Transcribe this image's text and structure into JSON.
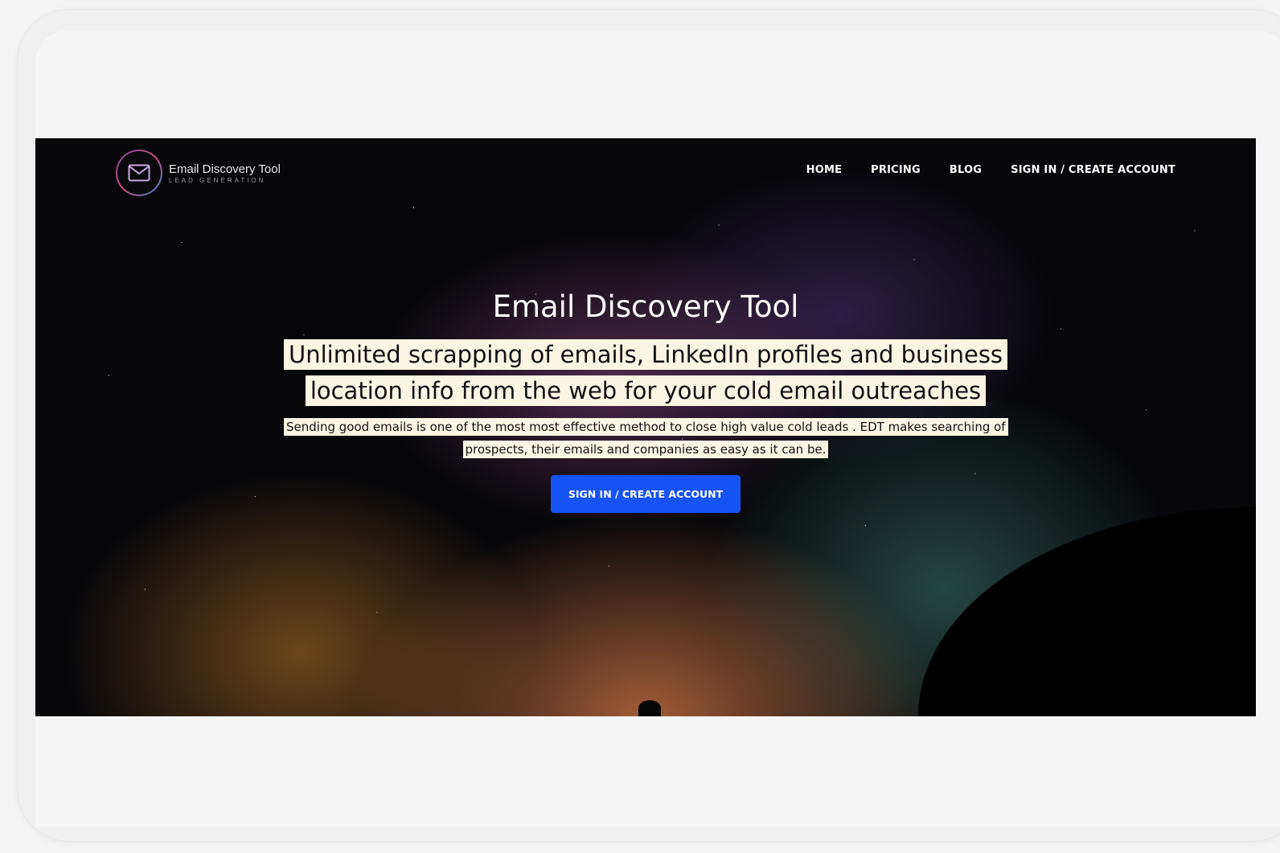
{
  "brand": {
    "name": "Email Discovery Tool",
    "tagline": "LEAD GENERATION"
  },
  "nav": {
    "items": [
      {
        "label": "HOME"
      },
      {
        "label": "PRICING"
      },
      {
        "label": "BLOG"
      },
      {
        "label": "SIGN IN / CREATE ACCOUNT"
      }
    ]
  },
  "hero": {
    "title": "Email Discovery Tool",
    "subtitle": "Unlimited scrapping of emails, LinkedIn profiles and business location info from the web for your cold email outreaches",
    "description": "Sending good emails is one of the most most effective method to close high value cold leads . EDT makes searching of prospects, their emails and companies as easy as it can be.",
    "cta_label": "SIGN IN / CREATE ACCOUNT"
  },
  "colors": {
    "cta": "#1553f5",
    "highlight": "#fbf5e3"
  },
  "icons": {
    "logo": "envelope-icon"
  }
}
